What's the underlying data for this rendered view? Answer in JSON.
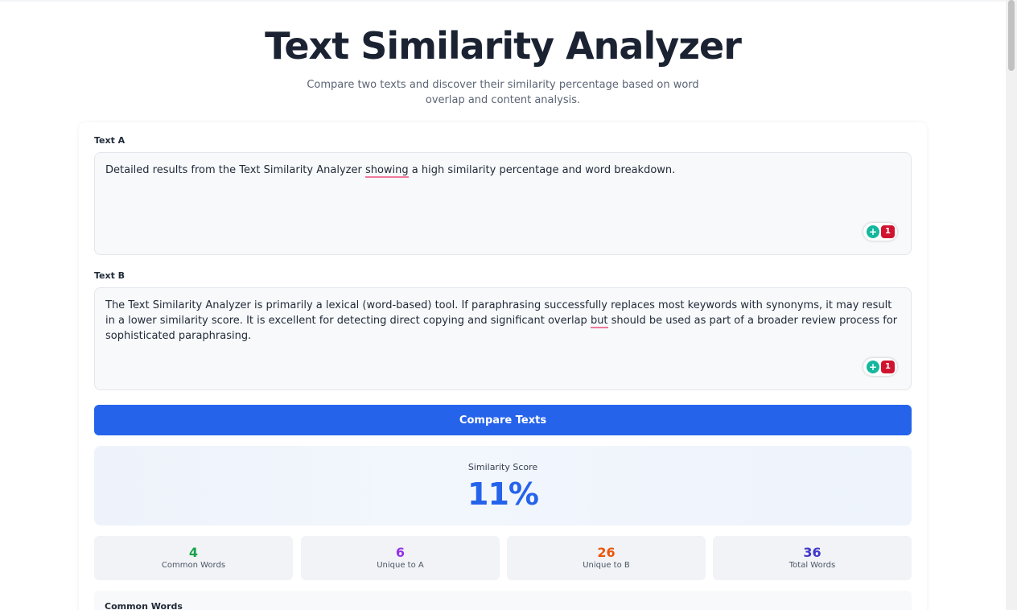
{
  "header": {
    "title": "Text Similarity Analyzer",
    "subtitle": "Compare two texts and discover their similarity percentage based on word overlap and content analysis."
  },
  "text_a": {
    "label": "Text A",
    "value_before": "Detailed results from the Text Similarity Analyzer ",
    "flagged_word": "showing",
    "value_after": " a high similarity percentage and word breakdown.",
    "grammar_count": "1"
  },
  "text_b": {
    "label": "Text B",
    "value_before": "The Text Similarity Analyzer is primarily a lexical (word-based) tool. If paraphrasing successfully replaces most keywords with synonyms, it may result in a lower similarity score. It is excellent for detecting direct copying and significant overlap ",
    "flagged_word": "but",
    "value_after": " should be used as part of a broader review process for sophisticated paraphrasing.",
    "grammar_count": "1"
  },
  "compare_button": {
    "label": "Compare Texts"
  },
  "result": {
    "score_label": "Similarity Score",
    "score_value": "11%"
  },
  "stats": [
    {
      "value": "4",
      "label": "Common Words",
      "color": "#16a34a"
    },
    {
      "value": "6",
      "label": "Unique to A",
      "color": "#9333ea"
    },
    {
      "value": "26",
      "label": "Unique to B",
      "color": "#ea580c"
    },
    {
      "value": "36",
      "label": "Total Words",
      "color": "#4338ca"
    }
  ],
  "common_words": {
    "title": "Common Words"
  },
  "icons": {
    "grammar": "lightbulb-icon"
  }
}
